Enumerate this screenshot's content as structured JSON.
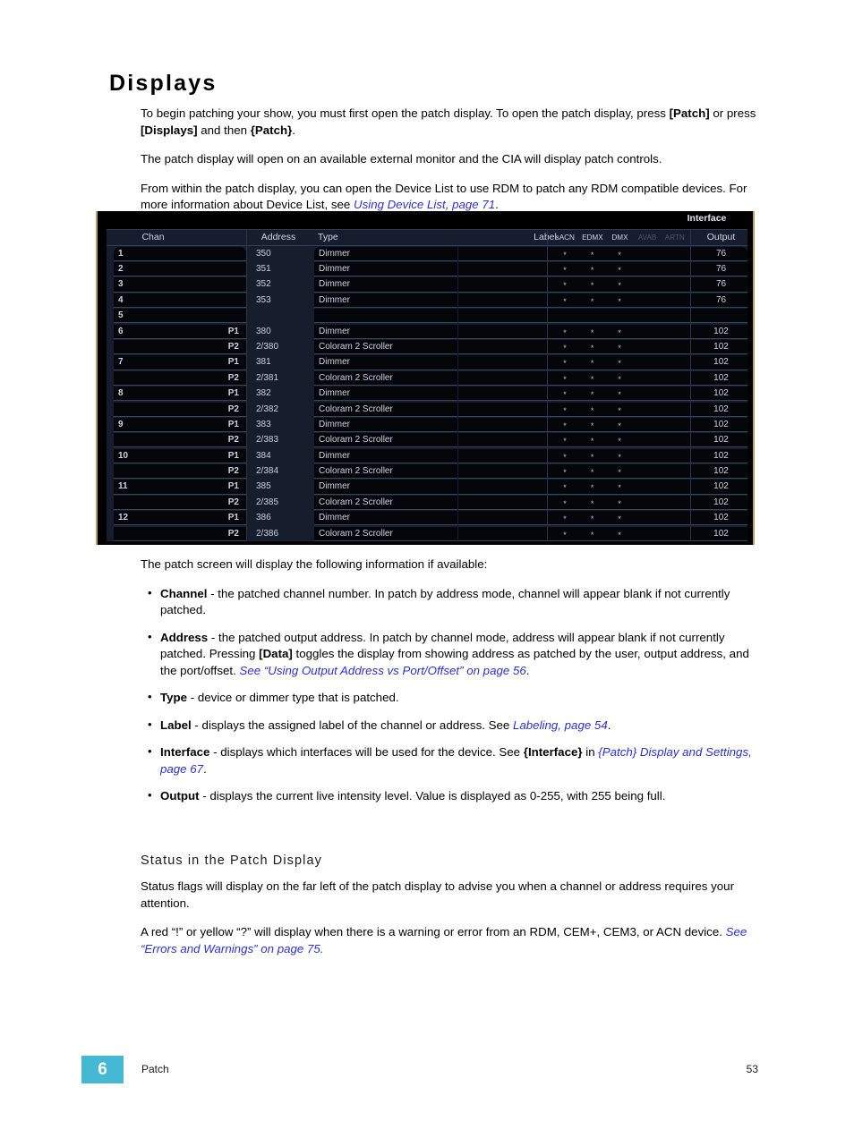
{
  "page": {
    "title": "Displays",
    "intro": [
      {
        "runs": [
          {
            "t": "To begin patching your show, you must first open the patch display. To open the patch display, press ",
            "s": "n"
          },
          {
            "t": "[Patch]",
            "s": "b"
          },
          {
            "t": " or press ",
            "s": "n"
          },
          {
            "t": "[Displays]",
            "s": "b"
          },
          {
            "t": " and then ",
            "s": "n"
          },
          {
            "t": "{Patch}",
            "s": "b"
          },
          {
            "t": ".",
            "s": "n"
          }
        ]
      },
      {
        "runs": [
          {
            "t": "The patch display will open on an available external monitor and the CIA will display patch controls.",
            "s": "n"
          }
        ]
      },
      {
        "runs": [
          {
            "t": "From within the patch display, you can open the Device List to use RDM to patch any RDM compatible devices. For more information about Device List, see ",
            "s": "n"
          },
          {
            "t": "Using Device List, page 71",
            "s": "l"
          },
          {
            "t": ".",
            "s": "n"
          }
        ]
      }
    ],
    "after_image_para": "The patch screen will display the following information if available:",
    "bullets": [
      {
        "runs": [
          {
            "t": "Channel",
            "s": "b"
          },
          {
            "t": " - the patched channel number. In patch by address mode, channel will appear blank if not currently patched.",
            "s": "n"
          }
        ]
      },
      {
        "runs": [
          {
            "t": "Address",
            "s": "b"
          },
          {
            "t": " - the patched output address. In patch by channel mode, address will appear blank if not currently patched. Pressing ",
            "s": "n"
          },
          {
            "t": "[Data]",
            "s": "b"
          },
          {
            "t": " toggles the display from showing address as patched by the user, output address, and the port/offset. ",
            "s": "n"
          },
          {
            "t": "See “Using Output Address vs Port/Offset” on page 56",
            "s": "l"
          },
          {
            "t": ".",
            "s": "n"
          }
        ]
      },
      {
        "runs": [
          {
            "t": "Type",
            "s": "b"
          },
          {
            "t": " - device or dimmer type that is patched.",
            "s": "n"
          }
        ]
      },
      {
        "runs": [
          {
            "t": "Label",
            "s": "b"
          },
          {
            "t": " - displays the assigned label of the channel or address. See ",
            "s": "n"
          },
          {
            "t": "Labeling, page 54",
            "s": "l"
          },
          {
            "t": ".",
            "s": "n"
          }
        ]
      },
      {
        "runs": [
          {
            "t": "Interface",
            "s": "b"
          },
          {
            "t": " - displays which interfaces will be used for the device. See ",
            "s": "n"
          },
          {
            "t": "{Interface}",
            "s": "b"
          },
          {
            "t": " in ",
            "s": "n"
          },
          {
            "t": "{Patch} Display and Settings, page 67",
            "s": "l"
          },
          {
            "t": ".",
            "s": "n"
          }
        ]
      },
      {
        "runs": [
          {
            "t": "Output",
            "s": "b"
          },
          {
            "t": " - displays the current live intensity level. Value is displayed as 0-255, with 255 being full.",
            "s": "n"
          }
        ]
      }
    ],
    "subsection": {
      "heading": "Status in the Patch Display",
      "paragraphs": [
        {
          "runs": [
            {
              "t": "Status flags will display on the far left of the patch display to advise you when a channel or address requires your attention.",
              "s": "n"
            }
          ]
        },
        {
          "runs": [
            {
              "t": "A red “!” or yellow “?” will display when there is a warning or error from an RDM, CEM+, CEM3, or ACN device. ",
              "s": "n"
            },
            {
              "t": "See “Errors and Warnings” on page 75.",
              "s": "l"
            }
          ]
        }
      ]
    }
  },
  "patch_display": {
    "interface_group_label": "Interface",
    "columns": {
      "chan": "Chan",
      "address": "Address",
      "type": "Type",
      "label": "Label",
      "output": "Output"
    },
    "interface_columns": [
      {
        "label": "sACN",
        "active": true
      },
      {
        "label": "EDMX",
        "active": true
      },
      {
        "label": "DMX",
        "active": true
      },
      {
        "label": "AVAB",
        "active": false
      },
      {
        "label": "ARTN",
        "active": false
      }
    ],
    "marker": "*",
    "rows": [
      {
        "chan": "1",
        "port": "",
        "address": "350",
        "type": "Dimmer",
        "label": "",
        "iface": [
          true,
          true,
          true,
          false,
          false
        ],
        "output": "76"
      },
      {
        "chan": "2",
        "port": "",
        "address": "351",
        "type": "Dimmer",
        "label": "",
        "iface": [
          true,
          true,
          true,
          false,
          false
        ],
        "output": "76"
      },
      {
        "chan": "3",
        "port": "",
        "address": "352",
        "type": "Dimmer",
        "label": "",
        "iface": [
          true,
          true,
          true,
          false,
          false
        ],
        "output": "76"
      },
      {
        "chan": "4",
        "port": "",
        "address": "353",
        "type": "Dimmer",
        "label": "",
        "iface": [
          true,
          true,
          true,
          false,
          false
        ],
        "output": "76"
      },
      {
        "chan": "5",
        "port": "",
        "address": "",
        "type": "",
        "label": "",
        "iface": [
          false,
          false,
          false,
          false,
          false
        ],
        "output": ""
      },
      {
        "chan": "6",
        "port": "P1",
        "address": "380",
        "type": "Dimmer",
        "label": "",
        "iface": [
          true,
          true,
          true,
          false,
          false
        ],
        "output": "102"
      },
      {
        "chan": "",
        "port": "P2",
        "address": "2/380",
        "type": "Coloram 2 Scroller",
        "label": "",
        "iface": [
          true,
          true,
          true,
          false,
          false
        ],
        "output": "102"
      },
      {
        "chan": "7",
        "port": "P1",
        "address": "381",
        "type": "Dimmer",
        "label": "",
        "iface": [
          true,
          true,
          true,
          false,
          false
        ],
        "output": "102"
      },
      {
        "chan": "",
        "port": "P2",
        "address": "2/381",
        "type": "Coloram 2 Scroller",
        "label": "",
        "iface": [
          true,
          true,
          true,
          false,
          false
        ],
        "output": "102"
      },
      {
        "chan": "8",
        "port": "P1",
        "address": "382",
        "type": "Dimmer",
        "label": "",
        "iface": [
          true,
          true,
          true,
          false,
          false
        ],
        "output": "102"
      },
      {
        "chan": "",
        "port": "P2",
        "address": "2/382",
        "type": "Coloram 2 Scroller",
        "label": "",
        "iface": [
          true,
          true,
          true,
          false,
          false
        ],
        "output": "102"
      },
      {
        "chan": "9",
        "port": "P1",
        "address": "383",
        "type": "Dimmer",
        "label": "",
        "iface": [
          true,
          true,
          true,
          false,
          false
        ],
        "output": "102"
      },
      {
        "chan": "",
        "port": "P2",
        "address": "2/383",
        "type": "Coloram 2 Scroller",
        "label": "",
        "iface": [
          true,
          true,
          true,
          false,
          false
        ],
        "output": "102"
      },
      {
        "chan": "10",
        "port": "P1",
        "address": "384",
        "type": "Dimmer",
        "label": "",
        "iface": [
          true,
          true,
          true,
          false,
          false
        ],
        "output": "102"
      },
      {
        "chan": "",
        "port": "P2",
        "address": "2/384",
        "type": "Coloram 2 Scroller",
        "label": "",
        "iface": [
          true,
          true,
          true,
          false,
          false
        ],
        "output": "102"
      },
      {
        "chan": "11",
        "port": "P1",
        "address": "385",
        "type": "Dimmer",
        "label": "",
        "iface": [
          true,
          true,
          true,
          false,
          false
        ],
        "output": "102"
      },
      {
        "chan": "",
        "port": "P2",
        "address": "2/385",
        "type": "Coloram 2 Scroller",
        "label": "",
        "iface": [
          true,
          true,
          true,
          false,
          false
        ],
        "output": "102"
      },
      {
        "chan": "12",
        "port": "P1",
        "address": "386",
        "type": "Dimmer",
        "label": "",
        "iface": [
          true,
          true,
          true,
          false,
          false
        ],
        "output": "102"
      },
      {
        "chan": "",
        "port": "P2",
        "address": "2/386",
        "type": "Coloram 2 Scroller",
        "label": "",
        "iface": [
          true,
          true,
          true,
          false,
          false
        ],
        "output": "102"
      }
    ]
  },
  "footer": {
    "chapter_number": "6",
    "chapter_label": "Patch",
    "page_number": "53"
  },
  "colors": {
    "accent_badge": "#45b8d4",
    "link": "#2b31d6",
    "panel_bg": "#161d2c",
    "cell_bg": "#04060a",
    "frame": "#b9a05c"
  }
}
